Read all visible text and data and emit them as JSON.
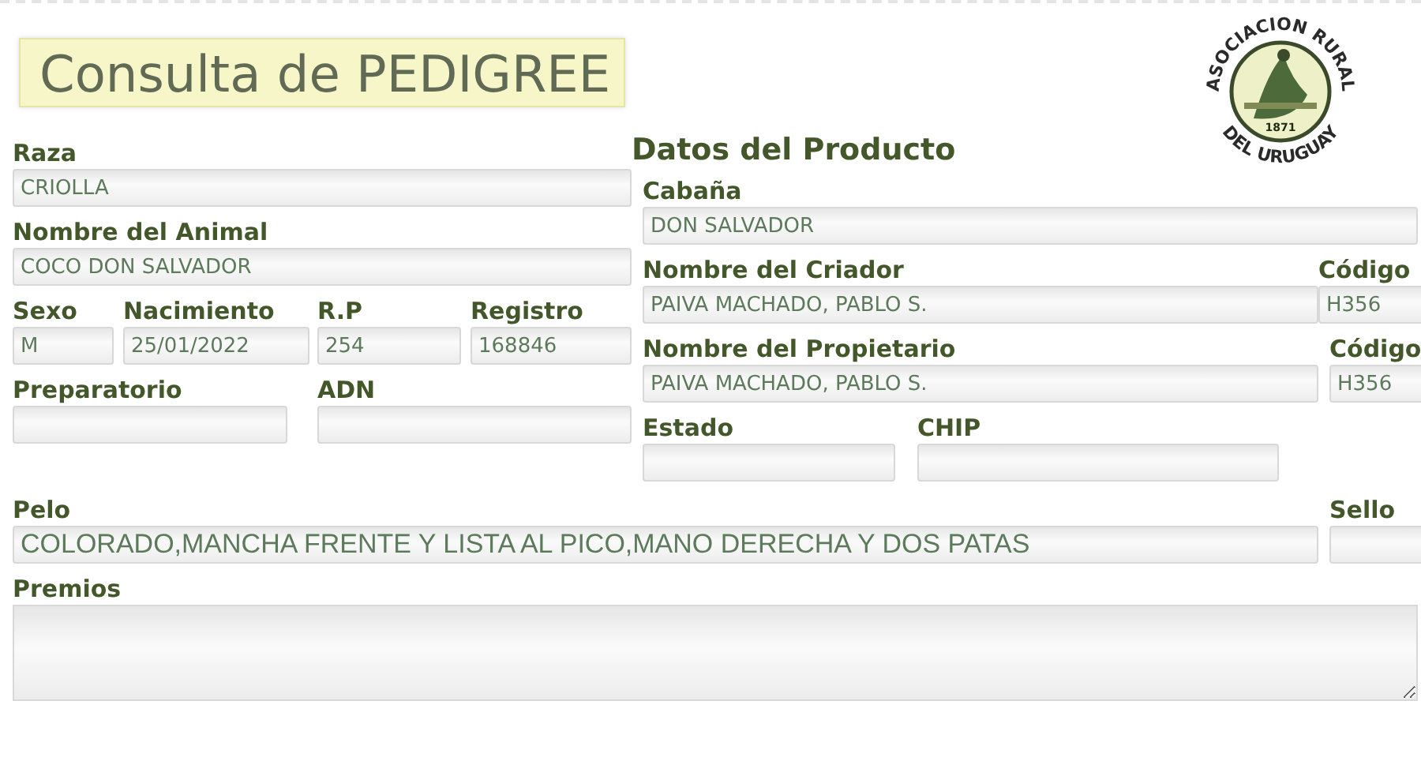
{
  "title": "Consulta de PEDIGREE",
  "logo": {
    "top_text": "ASOCIACION RURAL",
    "bottom_text": "DEL URUGUAY",
    "year": "1871"
  },
  "section_title": "Datos del Producto",
  "left_rows": [
    [
      {
        "label": "Raza",
        "value": "CRIOLLA"
      }
    ],
    [
      {
        "label": "Nombre del Animal",
        "value": "COCO DON SALVADOR"
      }
    ],
    [
      {
        "label": "Sexo",
        "value": "M"
      },
      {
        "label": "Nacimiento",
        "value": "25/01/2022"
      },
      {
        "label": "R.P",
        "value": "254"
      },
      {
        "label": "Registro",
        "value": "168846"
      }
    ],
    [
      {
        "label": "Preparatorio"
      },
      {
        "label": "ADN"
      }
    ]
  ],
  "right_rows": [
    [
      {
        "label": "Cabaña",
        "value": "DON SALVADOR"
      }
    ],
    [
      {
        "label": "Nombre del Criador",
        "value": "PAIVA MACHADO, PABLO S."
      },
      {
        "label": "Código",
        "value": "H356"
      }
    ],
    [
      {
        "label": "Nombre del Propietario",
        "value": "PAIVA MACHADO, PABLO S."
      },
      {
        "label": "Código",
        "value": "H356"
      }
    ],
    [
      {
        "label": "Estado"
      },
      {
        "label": "CHIP"
      }
    ]
  ],
  "pelo_row": [
    {
      "label": "Pelo",
      "value": "COLORADO,MANCHA FRENTE Y LISTA AL PICO,MANO DERECHA Y DOS PATAS"
    },
    {
      "label": "Sello"
    }
  ],
  "premios": {
    "label": "Premios"
  }
}
